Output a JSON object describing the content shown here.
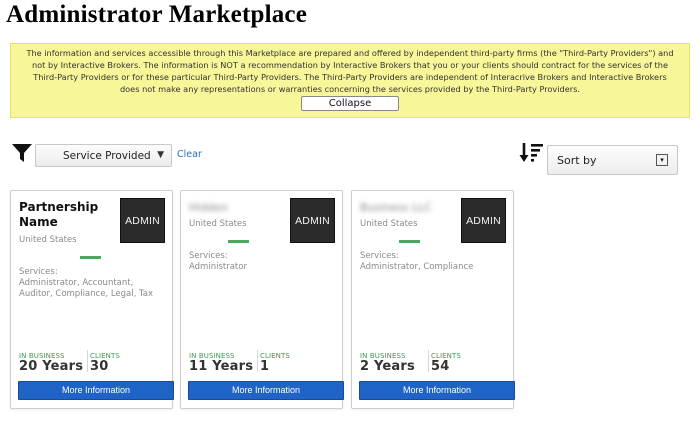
{
  "page": {
    "title": "Administrator Marketplace"
  },
  "disclaimer": {
    "text": "The information and services accessible through this Marketplace are prepared and offered by independent third-party firms (the \"Third-Party Providers\") and not by Interactive Brokers. The information is NOT a recommendation by Interactive Brokers that you or your clients should contract for the services of the Third-Party Providers or for these particular Third-Party Providers. The Third-Party Providers are independent of Interacrive Brokers and Interactive Brokers does not make any representations or warranties concerning the services provided by the Third-Party Providers.",
    "collapse_label": "Collapse"
  },
  "filter": {
    "icon": "filter-icon",
    "selected": "Service Provided",
    "caret": "▼",
    "clear_label": "Clear"
  },
  "sort": {
    "icon": "sort-descending-icon",
    "selected": "Sort by",
    "caret": "▾"
  },
  "colors": {
    "accent_blue": "#1f63c7",
    "disclaimer_bg": "#f7f79a",
    "green": "#4aa860"
  },
  "cards": [
    {
      "name": "Partnership Name",
      "country": "United States",
      "badge": "ADMIN",
      "services_label": "Services:",
      "services": "Administrator, Accountant, Auditor, Compliance, Legal, Tax",
      "in_business_label": "IN BUSINESS",
      "in_business_value": "20 Years",
      "clients_label": "CLIENTS",
      "clients_value": "30",
      "button_label": "More Information"
    },
    {
      "name": "Hidden",
      "country": "United States",
      "badge": "ADMIN",
      "services_label": "Services:",
      "services": "Administrator",
      "in_business_label": "IN BUSINESS",
      "in_business_value": "11 Years",
      "clients_label": "CLIENTS",
      "clients_value": "1",
      "button_label": "More Information"
    },
    {
      "name": "Business LLC",
      "country": "United States",
      "badge": "ADMIN",
      "services_label": "Services:",
      "services": "Administrator, Compliance",
      "in_business_label": "IN BUSINESS",
      "in_business_value": "2 Years",
      "clients_label": "CLIENTS",
      "clients_value": "54",
      "button_label": "More Information"
    }
  ]
}
